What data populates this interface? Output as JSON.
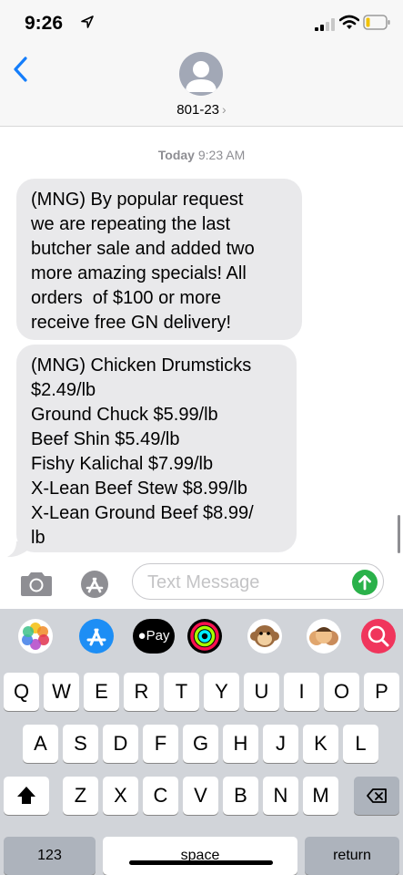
{
  "status_bar": {
    "time": "9:26"
  },
  "header": {
    "contact": "801-23",
    "chevron": "›"
  },
  "thread": {
    "timestamp_day": "Today",
    "timestamp_time": "9:23 AM",
    "messages": [
      {
        "text": "(MNG) By popular request\nwe are repeating the last\nbutcher sale and added two\nmore amazing specials! All\norders  of $100 or more\nreceive free GN delivery!"
      },
      {
        "text": "(MNG) Chicken Drumsticks\n$2.49/lb\nGround Chuck $5.99/lb\nBeef Shin $5.49/lb\nFishy Kalichal $7.99/lb\nX-Lean Beef Stew $8.99/lb\nX-Lean Ground Beef $8.99/\nlb"
      }
    ]
  },
  "composer": {
    "placeholder": "Text Message"
  },
  "app_strip": {
    "apple_pay_label": "Pay"
  },
  "keyboard": {
    "row1": [
      "Q",
      "W",
      "E",
      "R",
      "T",
      "Y",
      "U",
      "I",
      "O",
      "P"
    ],
    "row2": [
      "A",
      "S",
      "D",
      "F",
      "G",
      "H",
      "J",
      "K",
      "L"
    ],
    "row3": [
      "Z",
      "X",
      "C",
      "V",
      "B",
      "N",
      "M"
    ],
    "numbers_label": "123",
    "space_label": "space",
    "return_label": "return"
  },
  "colors": {
    "bubble": "#e9e9eb",
    "accent": "#157efb",
    "send": "#2ab14a",
    "keyboard_bg": "#d1d4d9"
  }
}
